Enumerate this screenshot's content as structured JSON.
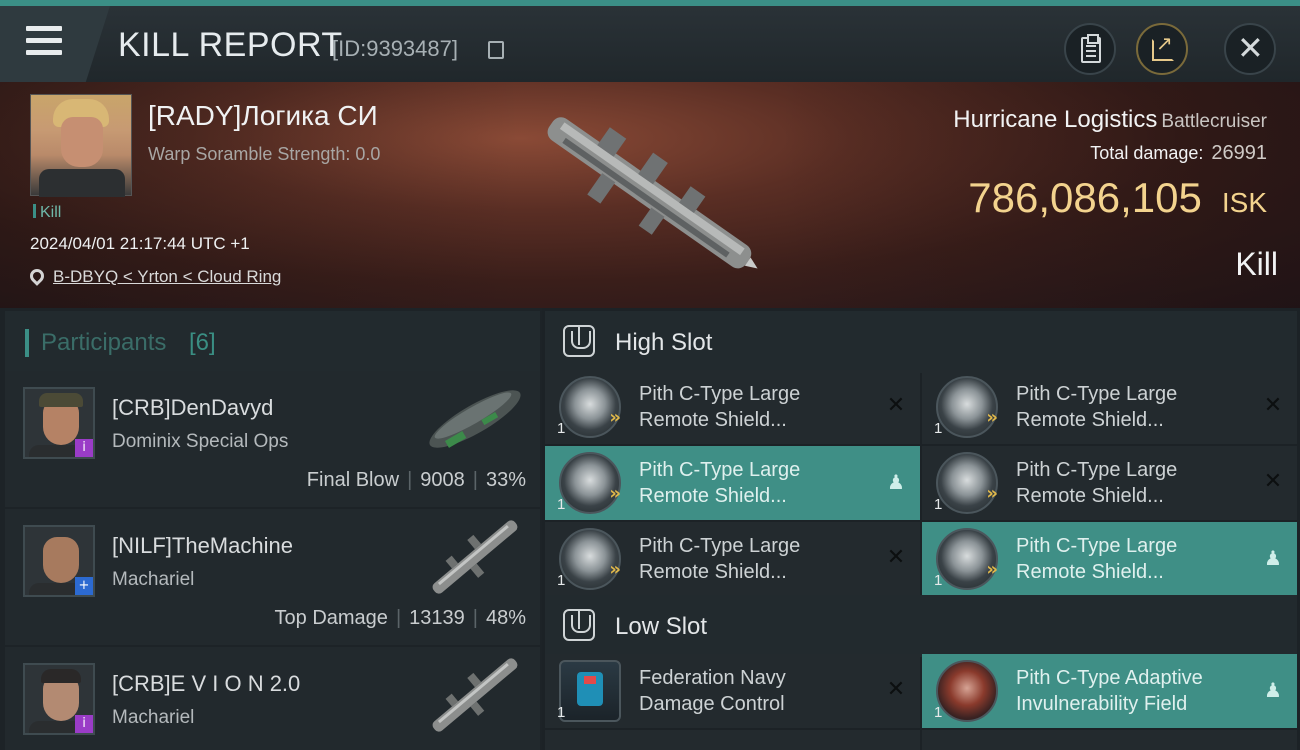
{
  "header": {
    "title": "KILL REPORT",
    "id_label": "[ID:9393487]"
  },
  "victim": {
    "name": "[RADY]Логика СИ",
    "subtitle": "Warp Soramble Strength: 0.0",
    "tag": "Kill",
    "datetime": "2024/04/01 21:17:44 UTC +1",
    "location": "B-DBYQ < Yrton < Cloud Ring"
  },
  "ship": {
    "name": "Hurricane Logistics",
    "class": "Battlecruiser",
    "total_damage_label": "Total damage:",
    "total_damage": "26991",
    "isk_value": "786,086,105",
    "isk_unit": "ISK",
    "result": "Kill"
  },
  "participants": {
    "title": "Participants",
    "count": "[6]",
    "rows": [
      {
        "name": "[CRB]DenDavyd",
        "ship": "Dominix Special Ops",
        "role": "Final Blow",
        "damage": "9008",
        "percent": "33%",
        "badge": "i"
      },
      {
        "name": "[NILF]TheMachine",
        "ship": "Machariel",
        "role": "Top Damage",
        "damage": "13139",
        "percent": "48%",
        "badge": "+"
      },
      {
        "name": "[CRB]E V I O N 2.0",
        "ship": "Machariel",
        "role": "",
        "damage": "",
        "percent": "",
        "badge": "i"
      }
    ]
  },
  "slots": {
    "high": {
      "title": "High Slot",
      "items": [
        {
          "name_line1": "Pith C-Type Large",
          "name_line2": "Remote Shield...",
          "qty": "1",
          "status": "destroyed"
        },
        {
          "name_line1": "Pith C-Type Large",
          "name_line2": "Remote Shield...",
          "qty": "1",
          "status": "destroyed"
        },
        {
          "name_line1": "Pith C-Type Large",
          "name_line2": "Remote Shield...",
          "qty": "1",
          "status": "dropped"
        },
        {
          "name_line1": "Pith C-Type Large",
          "name_line2": "Remote Shield...",
          "qty": "1",
          "status": "destroyed"
        },
        {
          "name_line1": "Pith C-Type Large",
          "name_line2": "Remote Shield...",
          "qty": "1",
          "status": "destroyed"
        },
        {
          "name_line1": "Pith C-Type Large",
          "name_line2": "Remote Shield...",
          "qty": "1",
          "status": "dropped"
        }
      ]
    },
    "low": {
      "title": "Low Slot",
      "items": [
        {
          "name_line1": "Federation Navy",
          "name_line2": "Damage Control",
          "qty": "1",
          "status": "destroyed"
        },
        {
          "name_line1": "Pith C-Type Adaptive",
          "name_line2": "Invulnerability Field",
          "qty": "1",
          "status": "dropped"
        }
      ]
    }
  },
  "icons": {
    "destroyed": "✕",
    "dropped": "person"
  },
  "colors": {
    "accent": "#3b8f86",
    "isk": "#f3d38e",
    "dropped_bg": "#3f8f86"
  }
}
